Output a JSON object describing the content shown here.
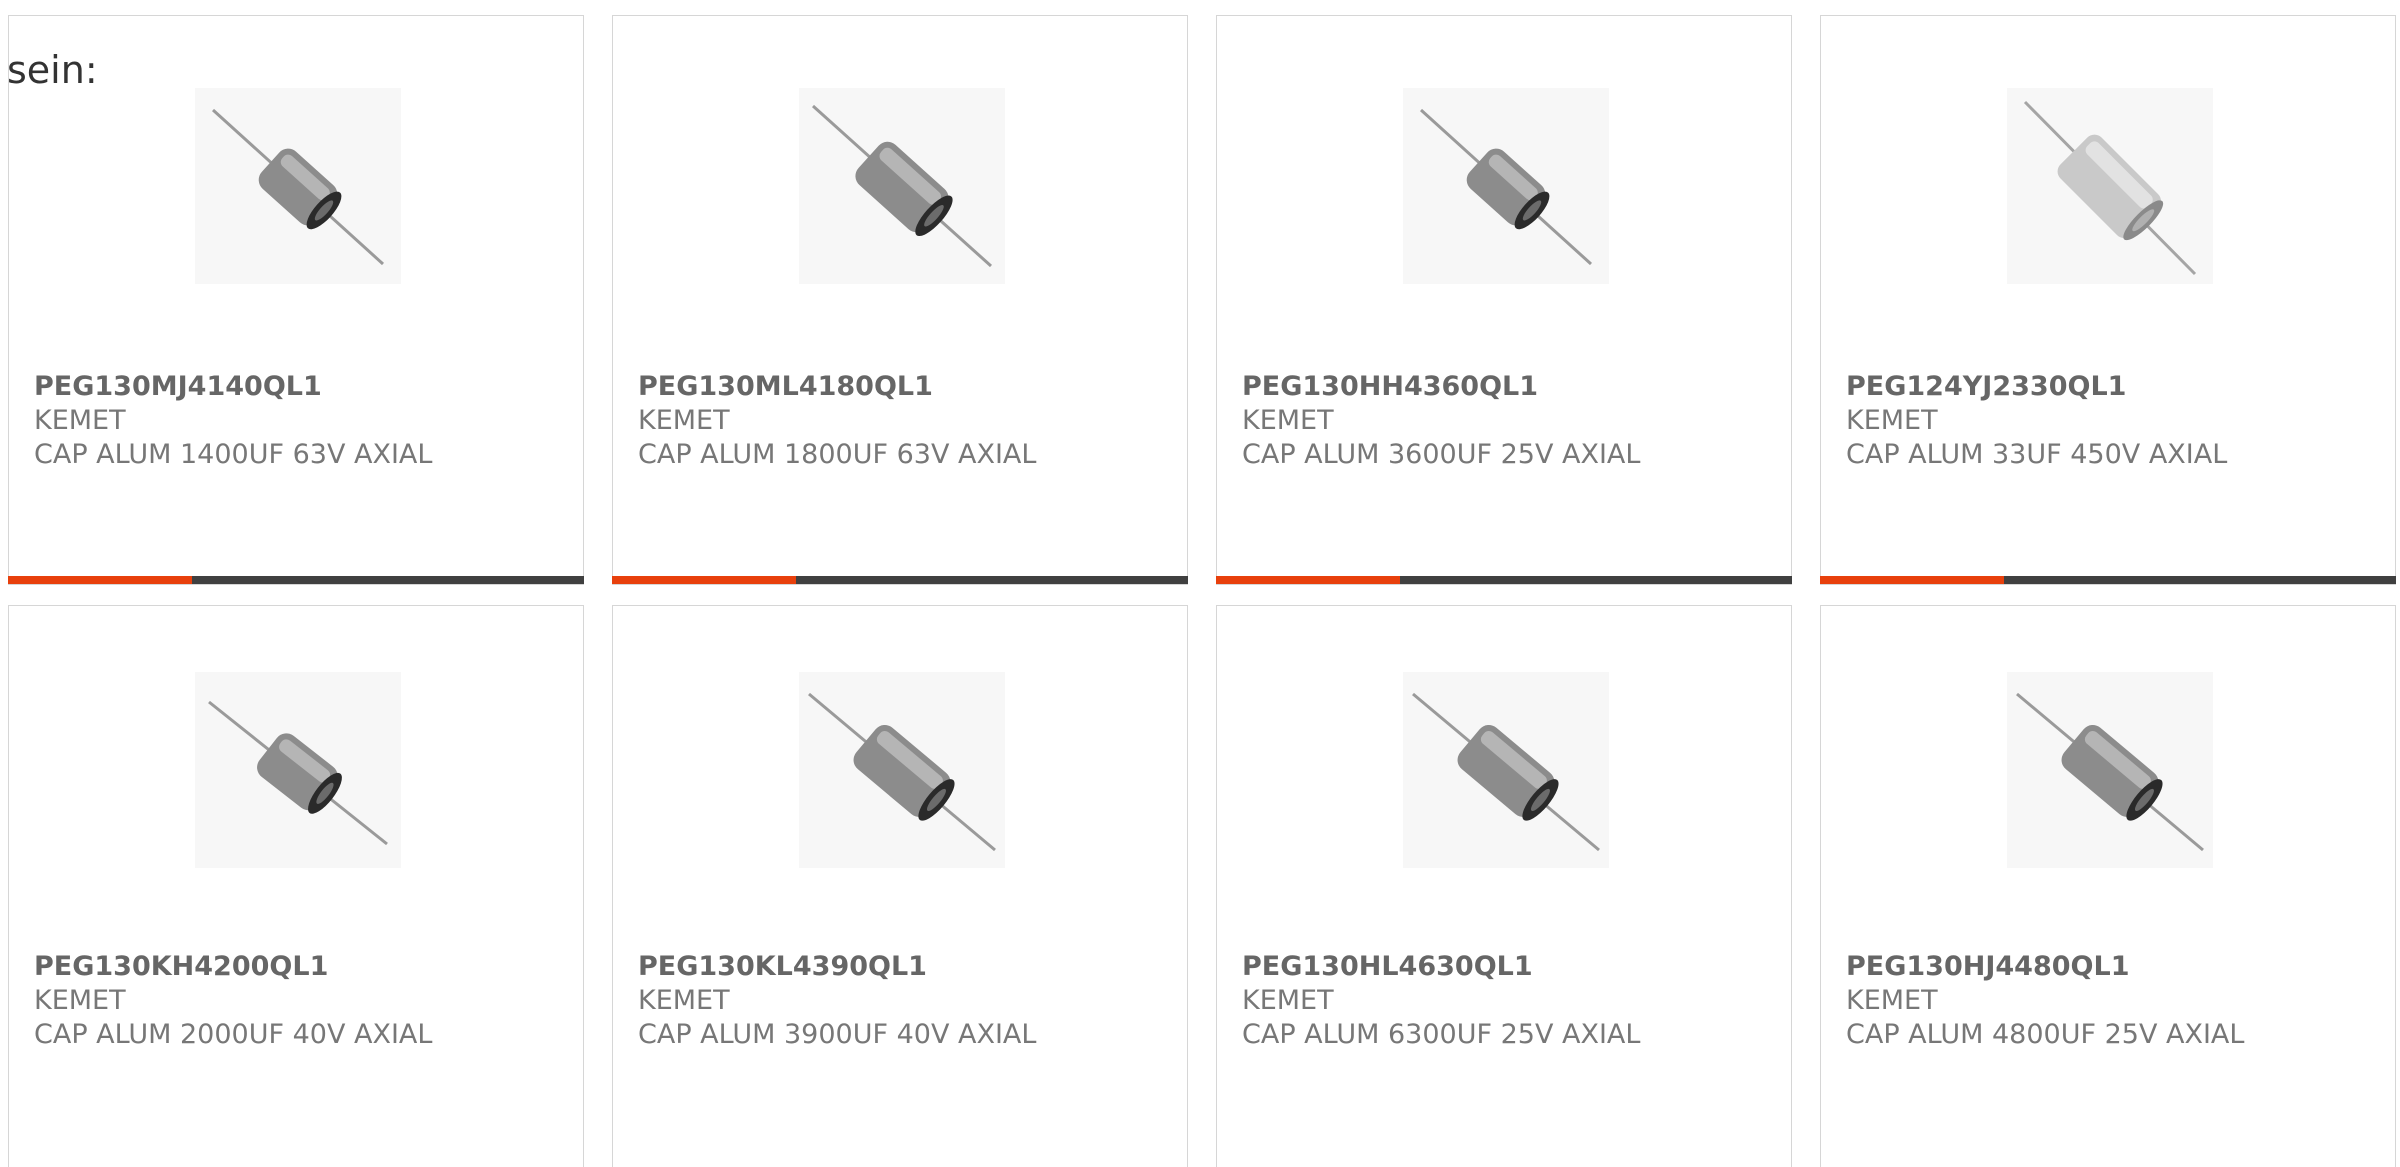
{
  "intro": {
    "text": "sein:"
  },
  "colors": {
    "accent": "#e8400c",
    "bar_track": "#404040",
    "text": "#666666",
    "border": "#d6d6d6"
  },
  "products": [
    {
      "part_number": "PEG130MJ4140QL1",
      "manufacturer": "KEMET",
      "description": "CAP ALUM 1400UF 63V AXIAL",
      "image_icon": "axial-capacitor-icon",
      "progress": 0.32
    },
    {
      "part_number": "PEG130ML4180QL1",
      "manufacturer": "KEMET",
      "description": "CAP ALUM 1800UF 63V AXIAL",
      "image_icon": "axial-capacitor-icon",
      "progress": 0.32
    },
    {
      "part_number": "PEG130HH4360QL1",
      "manufacturer": "KEMET",
      "description": "CAP ALUM 3600UF 25V AXIAL",
      "image_icon": "axial-capacitor-icon",
      "progress": 0.32
    },
    {
      "part_number": "PEG124YJ2330QL1",
      "manufacturer": "KEMET",
      "description": "CAP ALUM 33UF 450V AXIAL",
      "image_icon": "axial-capacitor-icon",
      "progress": 0.32
    },
    {
      "part_number": "PEG130KH4200QL1",
      "manufacturer": "KEMET",
      "description": "CAP ALUM 2000UF 40V AXIAL",
      "image_icon": "axial-capacitor-icon"
    },
    {
      "part_number": "PEG130KL4390QL1",
      "manufacturer": "KEMET",
      "description": "CAP ALUM 3900UF 40V AXIAL",
      "image_icon": "axial-capacitor-icon"
    },
    {
      "part_number": "PEG130HL4630QL1",
      "manufacturer": "KEMET",
      "description": "CAP ALUM 6300UF 25V AXIAL",
      "image_icon": "axial-capacitor-icon"
    },
    {
      "part_number": "PEG130HJ4480QL1",
      "manufacturer": "KEMET",
      "description": "CAP ALUM 4800UF 25V AXIAL",
      "image_icon": "axial-capacitor-icon"
    }
  ]
}
